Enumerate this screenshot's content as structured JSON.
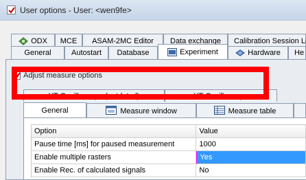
{
  "window": {
    "title": "User options - User: <wen9fe>"
  },
  "top_tabs": {
    "row1": [
      {
        "label": "ODX",
        "icon": "odx-icon"
      },
      {
        "label": "MCE"
      },
      {
        "label": "ASAM-2MC Editor"
      },
      {
        "label": "Data exchange"
      },
      {
        "label": "Calibration Session Lo"
      }
    ],
    "row2": [
      {
        "label": "General"
      },
      {
        "label": "Autostart"
      },
      {
        "label": "Database"
      },
      {
        "label": "Experiment",
        "icon": "experiment-icon",
        "active": true
      },
      {
        "label": "Hardware",
        "icon": "hardware-icon"
      },
      {
        "label": "He"
      }
    ]
  },
  "options": {
    "checkbox_label": "Adjust measure options",
    "checked": true
  },
  "osc_tabs": [
    {
      "label": "YT-Oscilloscope (outdated)"
    },
    {
      "label": "YT-Oscilloscope"
    }
  ],
  "inner_tabs": [
    {
      "label": "General",
      "active": true
    },
    {
      "label": "Measure window",
      "icon": "measure-window-icon"
    },
    {
      "label": "Measure table",
      "icon": "measure-table-icon"
    }
  ],
  "table": {
    "headers": [
      "Option",
      "Value"
    ],
    "rows": [
      {
        "option": "Pause time [ms] for paused measurement",
        "value": "1000"
      },
      {
        "option": "Enable multiple rasters",
        "value": "Yes"
      },
      {
        "option": "Enable Rec. of calculated signals",
        "value": "No"
      }
    ]
  },
  "colors": {
    "annotation": "#ff0000",
    "selection": "#3399ff"
  }
}
